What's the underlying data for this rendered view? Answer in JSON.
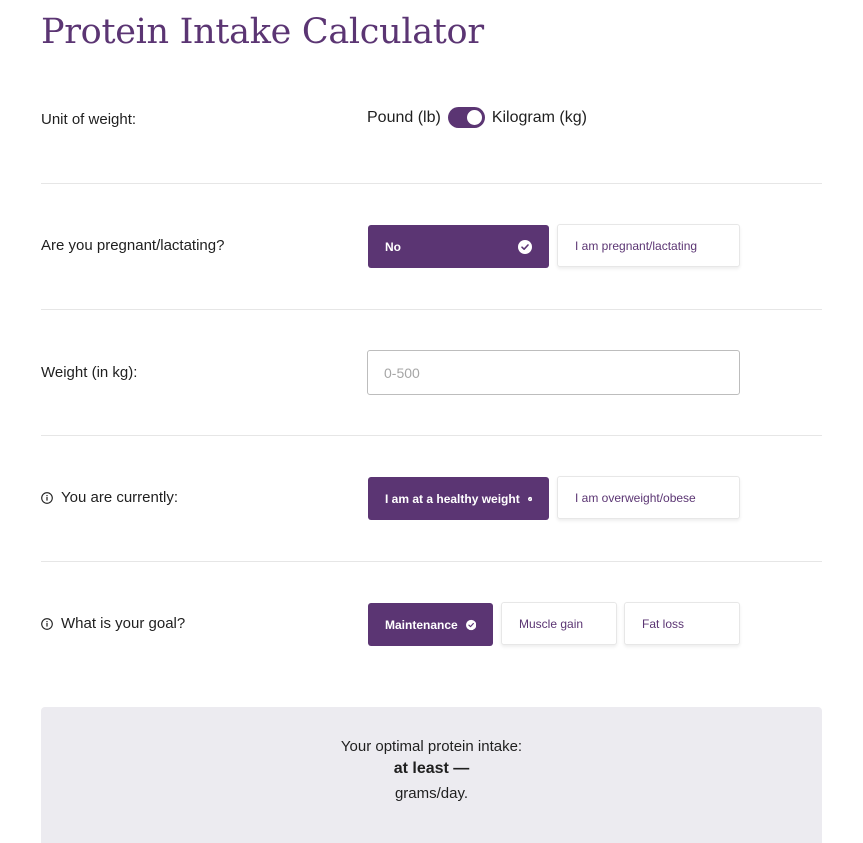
{
  "page": {
    "title": "Protein Intake Calculator"
  },
  "unit": {
    "label": "Unit of weight:",
    "left_option": "Pound (lb)",
    "right_option": "Kilogram (kg)",
    "selected": "Kilogram (kg)"
  },
  "pregnant": {
    "label": "Are you pregnant/lactating?",
    "options": [
      "No",
      "I am pregnant/lactating"
    ],
    "selected": "No"
  },
  "weight": {
    "label": "Weight (in kg):",
    "value": "",
    "placeholder": "0-500"
  },
  "current": {
    "label": "You are currently:",
    "options": [
      "I am at a healthy weight",
      "I am overweight/obese"
    ],
    "selected": "I am at a healthy weight"
  },
  "goal": {
    "label": "What is your goal?",
    "options": [
      "Maintenance",
      "Muscle gain",
      "Fat loss"
    ],
    "selected": "Maintenance"
  },
  "result": {
    "line1": "Your optimal protein intake:",
    "line2": "at least —",
    "line3": "grams/day."
  },
  "icons": {
    "info": "info-icon",
    "check": "check-circle-icon"
  },
  "colors": {
    "accent": "#5b3573",
    "result_bg": "#ecebf0"
  }
}
